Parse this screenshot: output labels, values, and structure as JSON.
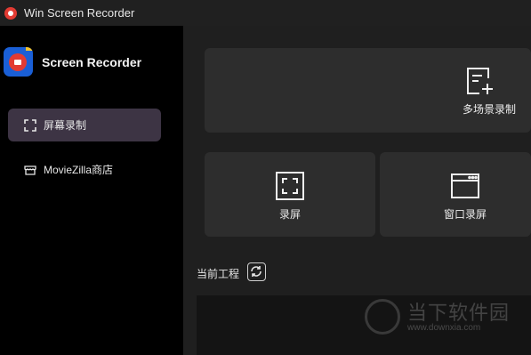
{
  "window": {
    "title": "Win Screen Recorder"
  },
  "sidebar": {
    "brand_name": "Screen Recorder",
    "items": [
      {
        "label": "屏幕录制",
        "icon": "screen-capture-icon",
        "active": true
      },
      {
        "label": "MovieZilla商店",
        "icon": "store-icon",
        "active": false
      }
    ]
  },
  "main": {
    "cards": {
      "multi_scene": {
        "label": "多场景录制",
        "icon": "add-scene-icon"
      },
      "record_screen": {
        "label": "录屏",
        "icon": "fullscreen-capture-icon"
      },
      "window_record": {
        "label": "窗口录屏",
        "icon": "window-icon"
      }
    },
    "project": {
      "label": "当前工程",
      "refresh_icon": "refresh-icon"
    }
  },
  "watermark": {
    "text": "当下软件园",
    "url": "www.downxia.com"
  },
  "colors": {
    "accent_active": "#3d3444",
    "card_bg": "#2d2d2d",
    "record_red": "#e23b33",
    "brand_blue": "#1a5fd6"
  }
}
